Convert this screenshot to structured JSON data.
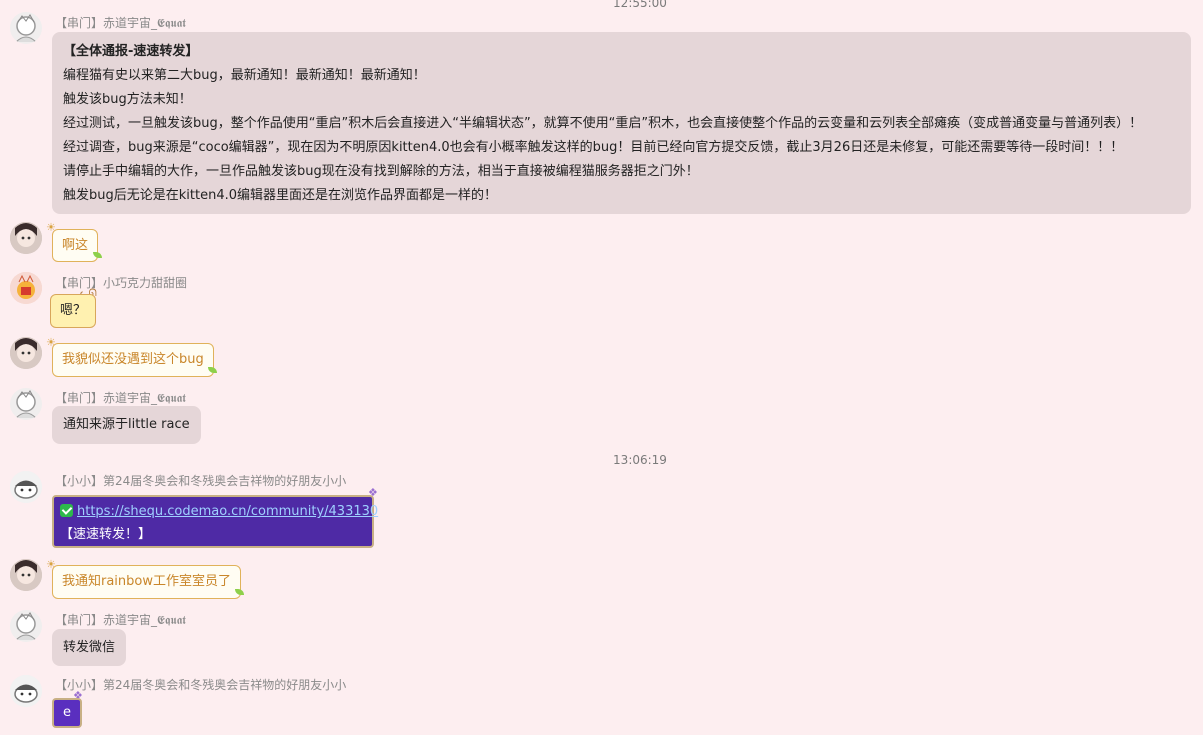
{
  "timestamps": [
    "12:55:00",
    "13:06:19"
  ],
  "messages": [
    {
      "sender": "【串门】赤道宇宙_𝕰𝖖𝖚𝖆𝖙",
      "lines": [
        "【全体通报-速速转发】",
        "编程猫有史以来第二大bug，最新通知！最新通知！最新通知！",
        "触发该bug方法未知！",
        "经过测试，一旦触发该bug，整个作品使用“重启”积木后会直接进入“半编辑状态”，就算不使用“重启”积木，也会直接使整个作品的云变量和云列表全部瘫痪（变成普通变量与普通列表）！",
        "经过调查，bug来源是“coco编辑器”，现在因为不明原因kitten4.0也会有小概率触发这样的bug！目前已经向官方提交反馈，截止3月26日还是未修复，可能还需要等待一段时间！！！",
        "请停止手中编辑的大作，一旦作品触发该bug现在没有找到解除的方法，相当于直接被编程猫服务器拒之门外！",
        "触发bug后无论是在kitten4.0编辑器里面还是在浏览作品界面都是一样的！"
      ]
    },
    {
      "text": "啊这"
    },
    {
      "sender": "【串门】小巧克力甜甜圈",
      "text": "嗯？"
    },
    {
      "text": "我貌似还没遇到这个bug"
    },
    {
      "sender": "【串门】赤道宇宙_𝕰𝖖𝖚𝖆𝖙",
      "text": "通知来源于little race"
    },
    {
      "sender": "【小小】第24届冬奥会和冬残奥会吉祥物的好朋友小小",
      "link": "https://shequ.codemao.cn/community/433130",
      "text": "【速速转发！】"
    },
    {
      "text": "我通知rainbow工作室室员了"
    },
    {
      "sender": "【串门】赤道宇宙_𝕰𝖖𝖚𝖆𝖙",
      "text": "转发微信"
    },
    {
      "sender": "【小小】第24届冬奥会和冬残奥会吉祥物的好朋友小小",
      "text": "e"
    }
  ],
  "icons": {
    "verified": "check-badge-icon",
    "bubble_leaf": "leaf-icon"
  },
  "colors": {
    "background": "#fdeef0",
    "gray_bubble": "#e5d6d8",
    "cream_text": "#c9862a",
    "purple_bubble": "#4e2aa5"
  }
}
